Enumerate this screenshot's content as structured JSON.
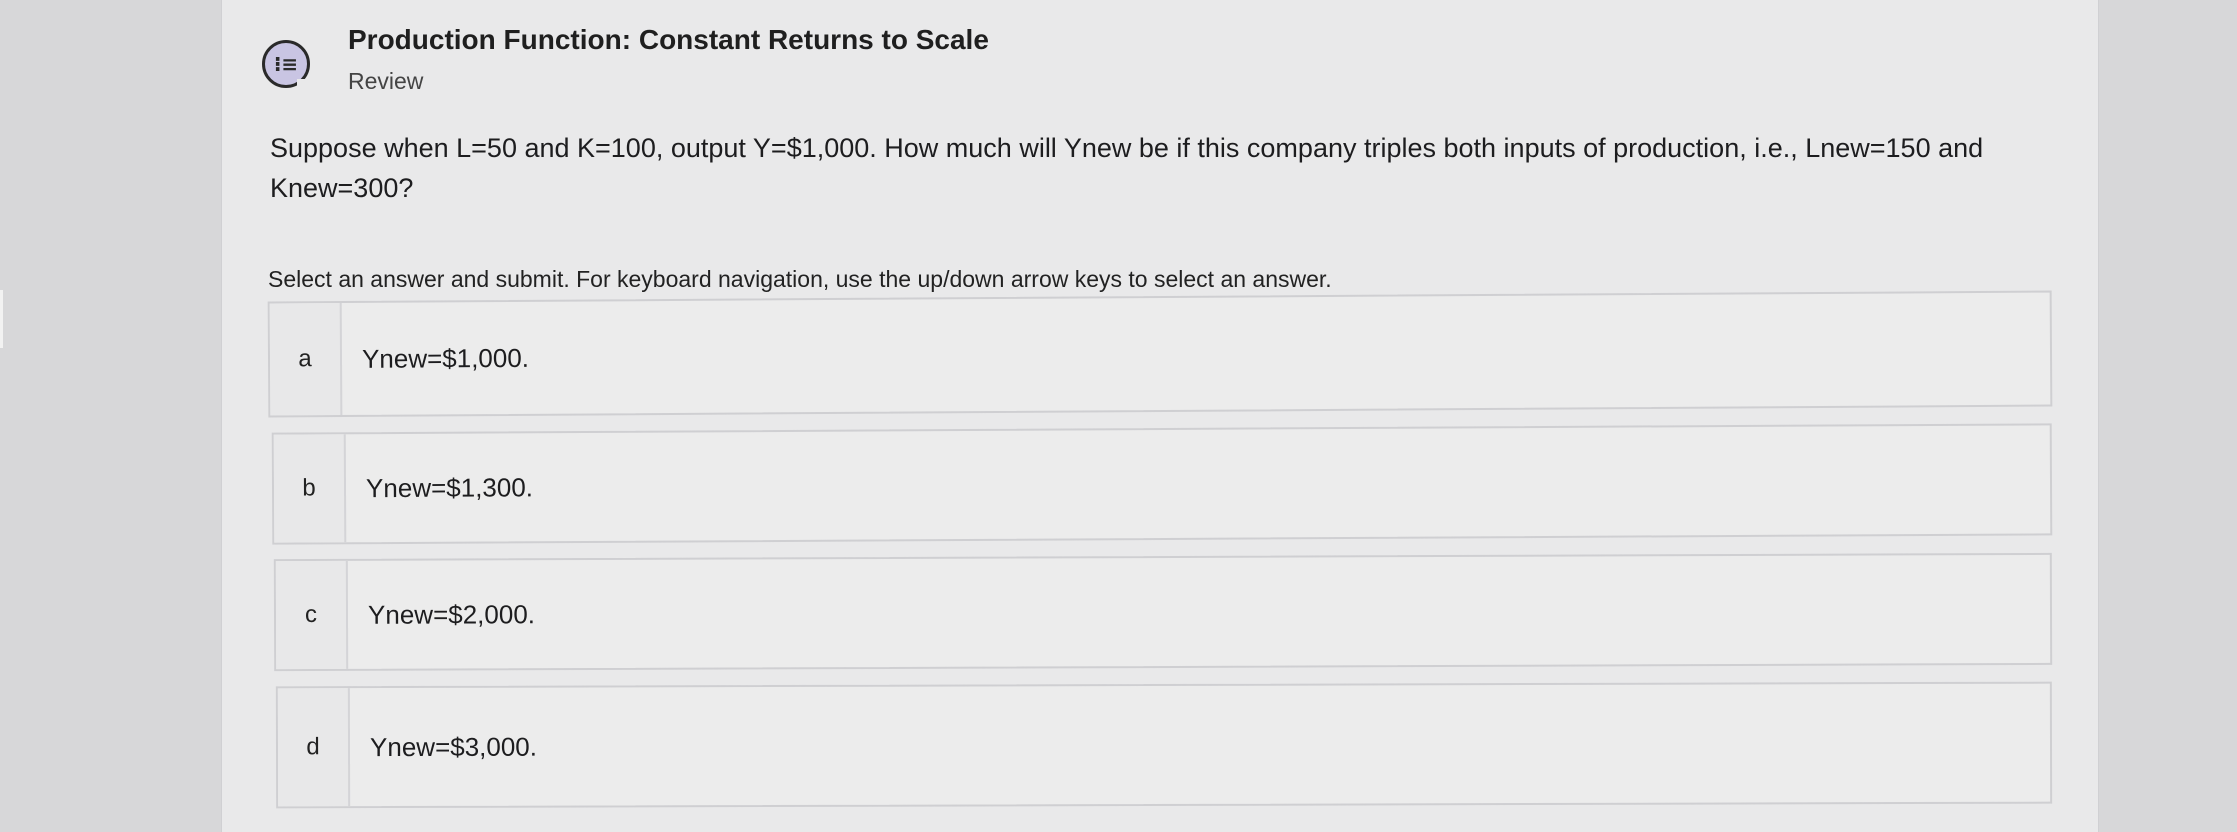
{
  "header": {
    "icon": "list-icon",
    "icon_glyph": "⁝≡",
    "title": "Production Function: Constant Returns to Scale",
    "subtitle": "Review"
  },
  "question": {
    "text": "Suppose when L=50 and K=100, output Y=$1,000. How much will Ynew be if this company triples both inputs of production, i.e., Lnew=150 and Knew=300?",
    "instructions": "Select an answer and submit. For keyboard navigation, use the up/down arrow keys to select an answer."
  },
  "options": [
    {
      "letter": "a",
      "text": "Ynew=$1,000."
    },
    {
      "letter": "b",
      "text": "Ynew=$1,300."
    },
    {
      "letter": "c",
      "text": "Ynew=$2,000."
    },
    {
      "letter": "d",
      "text": "Ynew=$3,000."
    }
  ],
  "colors": {
    "page_background": "#d7d7d9",
    "card_background": "#e9e9ea",
    "icon_fill": "#c9c5e3"
  }
}
